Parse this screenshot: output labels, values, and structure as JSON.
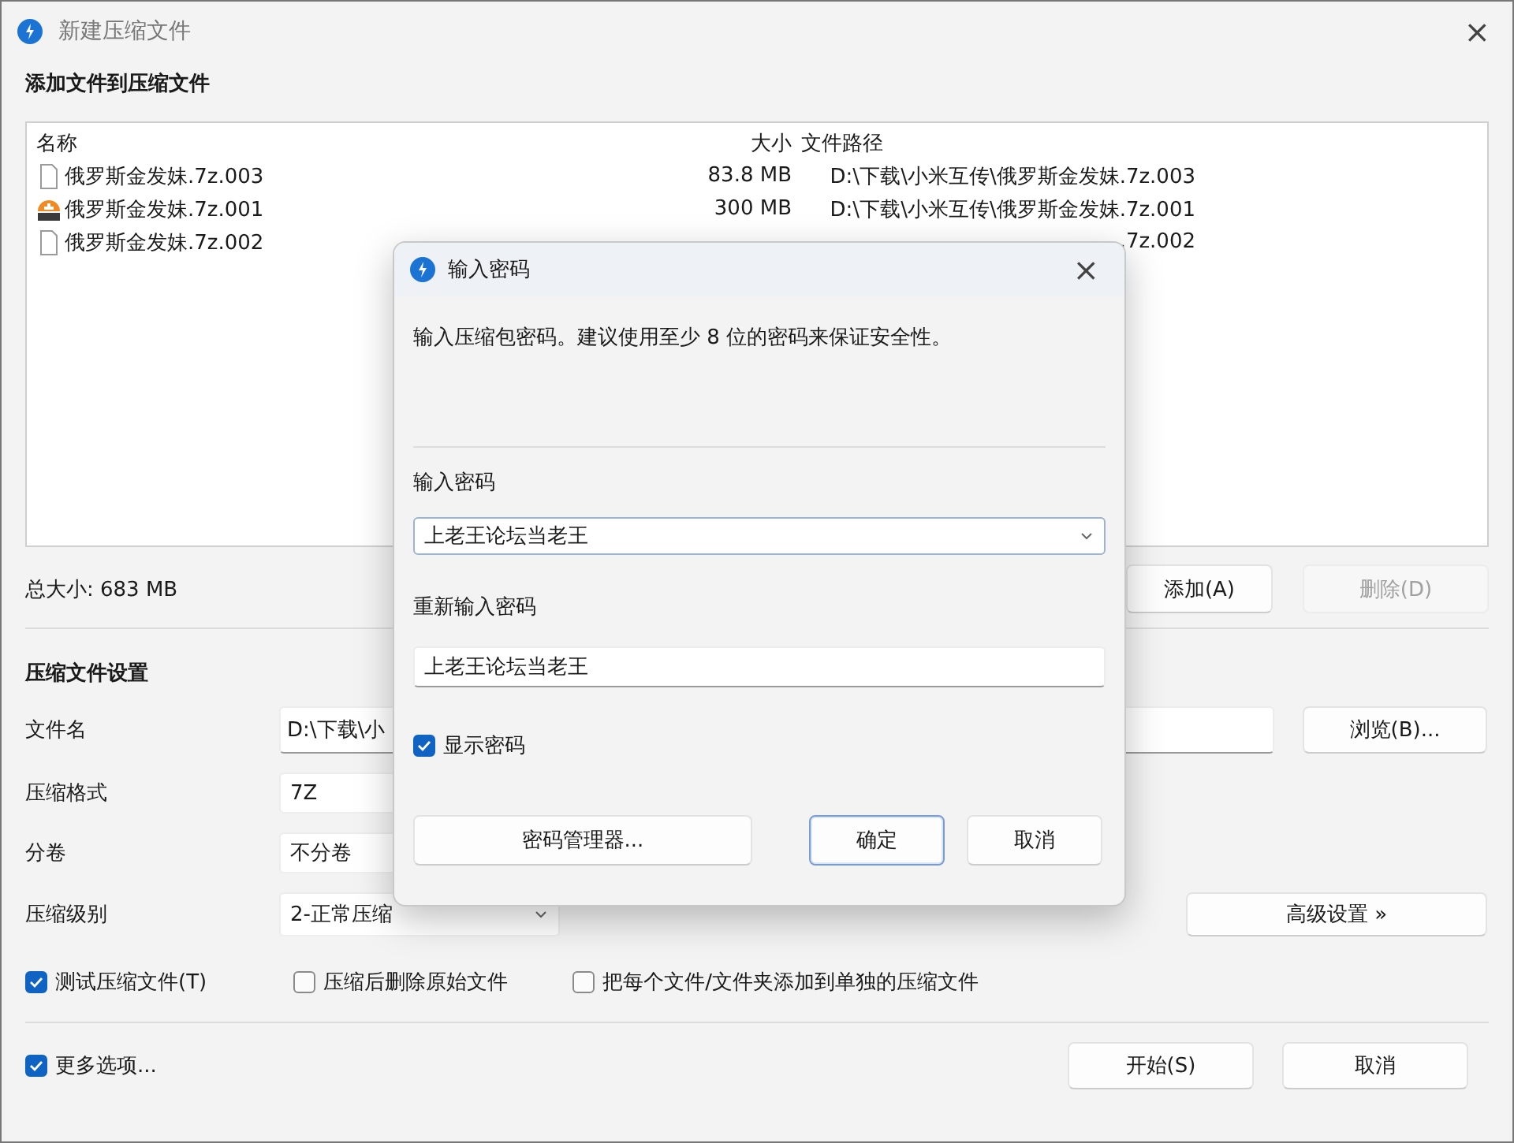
{
  "window": {
    "title": "新建压缩文件",
    "close": "×"
  },
  "files_section": {
    "heading": "添加文件到压缩文件",
    "columns": [
      "名称",
      "大小",
      "文件路径"
    ],
    "rows": [
      {
        "kind": "document",
        "name": "俄罗斯金发妹.7z.003",
        "size": "83.8 MB",
        "path": "D:\\下载\\小米互传\\俄罗斯金发妹.7z.003"
      },
      {
        "kind": "archive",
        "name": "俄罗斯金发妹.7z.001",
        "size": "300 MB",
        "path": "D:\\下载\\小米互传\\俄罗斯金发妹.7z.001"
      },
      {
        "kind": "document",
        "name": "俄罗斯金发妹.7z.002",
        "path": ".7z.002"
      }
    ],
    "total": "总大小: 683 MB",
    "buttons": [
      {
        "label": "添加(A)",
        "disabled": false
      },
      {
        "label": "删除(D)",
        "disabled": true
      }
    ]
  },
  "settings": {
    "heading": "压缩文件设置",
    "fields": [
      {
        "kind": "text",
        "label": "文件名",
        "value": "D:\\下载\\小",
        "button": "浏览(B)..."
      },
      {
        "kind": "box",
        "label": "压缩格式",
        "value": "7Z"
      },
      {
        "kind": "box",
        "label": "分卷",
        "value": "不分卷"
      },
      {
        "kind": "dropdown",
        "label": "压缩级别",
        "value": "2-正常压缩",
        "button": "高级设置 »"
      }
    ],
    "options": [
      {
        "label": "测试压缩文件(T)",
        "checked": true
      },
      {
        "label": "压缩后删除原始文件",
        "checked": false
      },
      {
        "label": "把每个文件/文件夹添加到单独的压缩文件",
        "checked": false
      }
    ]
  },
  "footer": {
    "more_options": {
      "label": "更多选项...",
      "checked": true
    },
    "buttons": [
      {
        "label": "开始(S)"
      },
      {
        "label": "取消"
      }
    ]
  },
  "dialog": {
    "title": "输入密码",
    "close": "×",
    "description": "输入压缩包密码。建议使用至少 8 位的密码来保证安全性。",
    "password_label": "输入密码",
    "password": "上老王论坛当老王",
    "confirm_label": "重新输入密码",
    "confirm": "上老王论坛当老王",
    "show_password": {
      "label": "显示密码",
      "checked": true
    },
    "buttons": [
      {
        "label": "密码管理器...",
        "focused": false
      },
      {
        "label": "确定",
        "focused": true
      },
      {
        "label": "取消",
        "focused": false
      }
    ]
  }
}
